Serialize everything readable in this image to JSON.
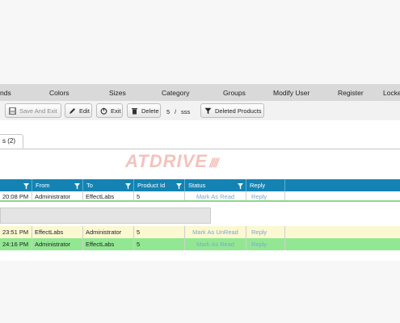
{
  "menu": {
    "items": [
      "nds",
      "Colors",
      "Sizes",
      "Category",
      "Groups",
      "Modify User",
      "Register",
      "Locke"
    ]
  },
  "toolbar": {
    "save_exit_label": "Save And Exit",
    "edit_label": "Edit",
    "exit_label": "Exit",
    "delete_label": "Delete",
    "pager_current": "5",
    "pager_sep": "/",
    "pager_total": "sss",
    "deleted_products_label": "Deleted Products"
  },
  "tabs": {
    "messages_label": "s (2)"
  },
  "logo": {
    "text": "ATDRIVE"
  },
  "grid": {
    "columns": [
      "",
      "From",
      "To",
      "Product Id",
      "Status",
      "Reply"
    ],
    "rows": [
      {
        "time": "20:08 PM",
        "from": "Administrator",
        "to": "EffectLabs",
        "product_id": "5",
        "status": "Mark As Read",
        "reply": "Reply"
      },
      {
        "time": "23:51 PM",
        "from": "EffectLabs",
        "to": "Administrator",
        "product_id": "5",
        "status": "Mark As UnRead",
        "reply": "Reply"
      },
      {
        "time": "24:16 PM",
        "from": "Administrator",
        "to": "EffectLabs",
        "product_id": "5",
        "status": "Mark As Read",
        "reply": "Reply"
      }
    ]
  },
  "colors": {
    "header_blue": "#1483b3",
    "row_yellow": "#fbf8d2",
    "row_green": "#92e892",
    "selected_border": "#8ed88e"
  }
}
